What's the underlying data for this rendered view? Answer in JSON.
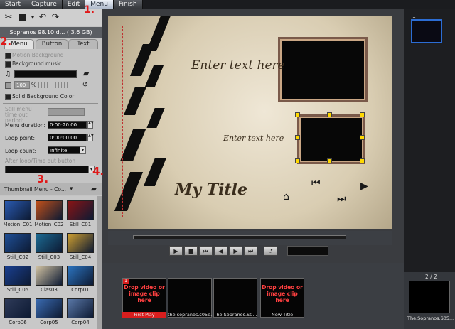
{
  "menu": {
    "tabs": [
      "Start",
      "Capture",
      "Edit",
      "Menu",
      "Finish"
    ],
    "active": "Menu"
  },
  "project": {
    "file_label": "Sopranos 98.10.d... ( 3.6 GB)"
  },
  "panel_tabs": [
    "Menu",
    "Button",
    "Text"
  ],
  "menu_settings": {
    "motion_background": "Motion Background",
    "background_music": "Background music:",
    "volume_value": "100",
    "volume_unit": "%",
    "solid_background": "Solid Background Color",
    "still_menu_timeout": "Still menu time out period:",
    "menu_duration_label": "Menu duration:",
    "menu_duration_value": "0:00:20.00",
    "loop_point_label": "Loop point:",
    "loop_point_value": "0:00:00.00",
    "loop_count_label": "Loop count:",
    "loop_count_value": "Infinite",
    "after_loop_label": "After loop/Time out button"
  },
  "thumbnails": {
    "header": "Thumbnail Menu - Co...",
    "items": [
      {
        "label": "Motion_C01",
        "color": "#2a5ab0"
      },
      {
        "label": "Motion_C02",
        "color": "#c0501a"
      },
      {
        "label": "Still_C01",
        "color": "#8a1414"
      },
      {
        "label": "Still_C02",
        "color": "#1f4f96"
      },
      {
        "label": "Still_C03",
        "color": "#1c6a92"
      },
      {
        "label": "Still_C04",
        "color": "#d0a030"
      },
      {
        "label": "Still_C05",
        "color": "#1a3f8f"
      },
      {
        "label": "Clas03",
        "color": "#cfc0a0"
      },
      {
        "label": "Corp01",
        "color": "#2c74c0"
      },
      {
        "label": "Corp06",
        "color": "#2e3a58"
      },
      {
        "label": "Corp05",
        "color": "#3a6ab0"
      },
      {
        "label": "Corp04",
        "color": "#5a78a8"
      }
    ]
  },
  "preview": {
    "text_1": "Enter text here",
    "text_2": "Enter text here",
    "title": "My Title"
  },
  "timeline": {
    "slots": [
      {
        "drop_text": "Drop video or image clip here",
        "label": "First Play",
        "badge": "1"
      },
      {
        "drop_text": "",
        "label": "the.sopranos.s05e..."
      },
      {
        "drop_text": "",
        "label": "The.Sopranos.S0..."
      },
      {
        "drop_text": "Drop video or image clip here",
        "label": "New Title"
      }
    ],
    "right_page": "2 / 2",
    "right_label": "The.Sopranos.S05..."
  },
  "strip": {
    "page_badge": "1"
  },
  "annotations": [
    "1.",
    "2.",
    "3.",
    "4."
  ],
  "colors": {
    "accent_red": "#e01818",
    "menu_active": "#c7d1e0"
  }
}
